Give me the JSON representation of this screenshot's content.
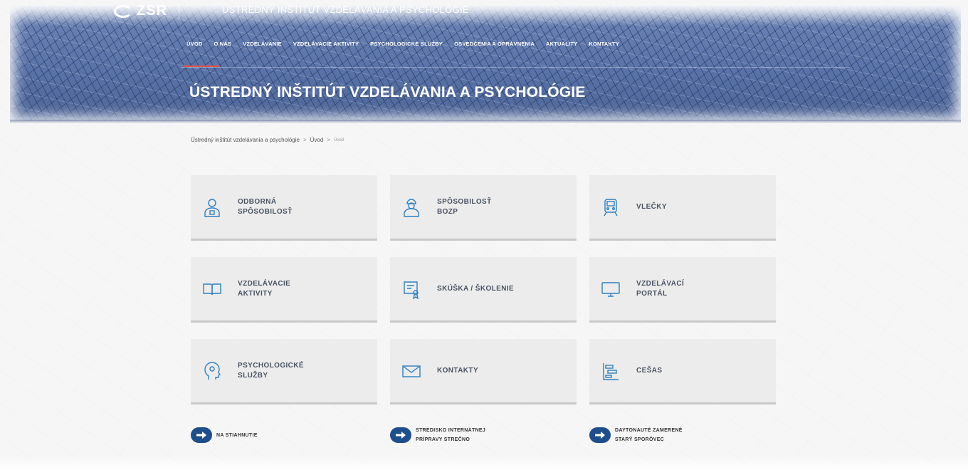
{
  "header": {
    "logo_text": "ZSR",
    "site_title": "ÚSTREDNÝ INŠTITÚT VZDELÁVANIA A PSYCHOLÓGIE",
    "page_title": "ÚSTREDNÝ INŠTITÚT VZDELÁVANIA A PSYCHOLÓGIE",
    "nav": [
      "ÚVOD",
      "O NÁS",
      "VZDELÁVANIE",
      "VZDELÁVACIE AKTIVITY",
      "PSYCHOLOGICKÉ SLUŽBY",
      "OSVEDČENIA A OPRÁVNENIA",
      "AKTUALITY",
      "KONTAKTY"
    ]
  },
  "breadcrumb": {
    "items": [
      "Ústredný inštitút vzdelávania a psychológie",
      "Úvod"
    ],
    "current": "Úvod",
    "separator": ">"
  },
  "tiles": [
    {
      "label": "ODBORNÁ\nSPÔSOBILOSŤ",
      "icon": "person-certificate-icon"
    },
    {
      "label": "SPÔSOBILOSŤ\nBOZP",
      "icon": "worker-icon"
    },
    {
      "label": "VLEČKY",
      "icon": "train-icon"
    },
    {
      "label": "VZDELÁVACIE\nAKTIVITY",
      "icon": "open-book-icon"
    },
    {
      "label": "SKÚŠKA / ŠKOLENIE",
      "icon": "certificate-icon"
    },
    {
      "label": "VZDELÁVACÍ\nPORTÁL",
      "icon": "monitor-icon"
    },
    {
      "label": "PSYCHOLOGICKÉ\nSLUŽBY",
      "icon": "head-icon"
    },
    {
      "label": "KONTAKTY",
      "icon": "envelope-icon"
    },
    {
      "label": "CEŠAS",
      "icon": "schedule-icon"
    }
  ],
  "bottom_links": [
    {
      "label": "NA STIAHNUTIE"
    },
    {
      "label": "STREDISKO INTERNÁTNEJ\nPRÍPRAVY STREČNO"
    },
    {
      "label": "DAYTONAUTÉ ZAMERENÉ\nSTARÝ SPORÔVEC"
    }
  ],
  "colors": {
    "accent_red": "#e2574c",
    "icon_blue": "#2f7fbf",
    "button_blue": "#1e4f8a",
    "tile_bg": "#ececec",
    "tile_text": "#4a5363"
  }
}
